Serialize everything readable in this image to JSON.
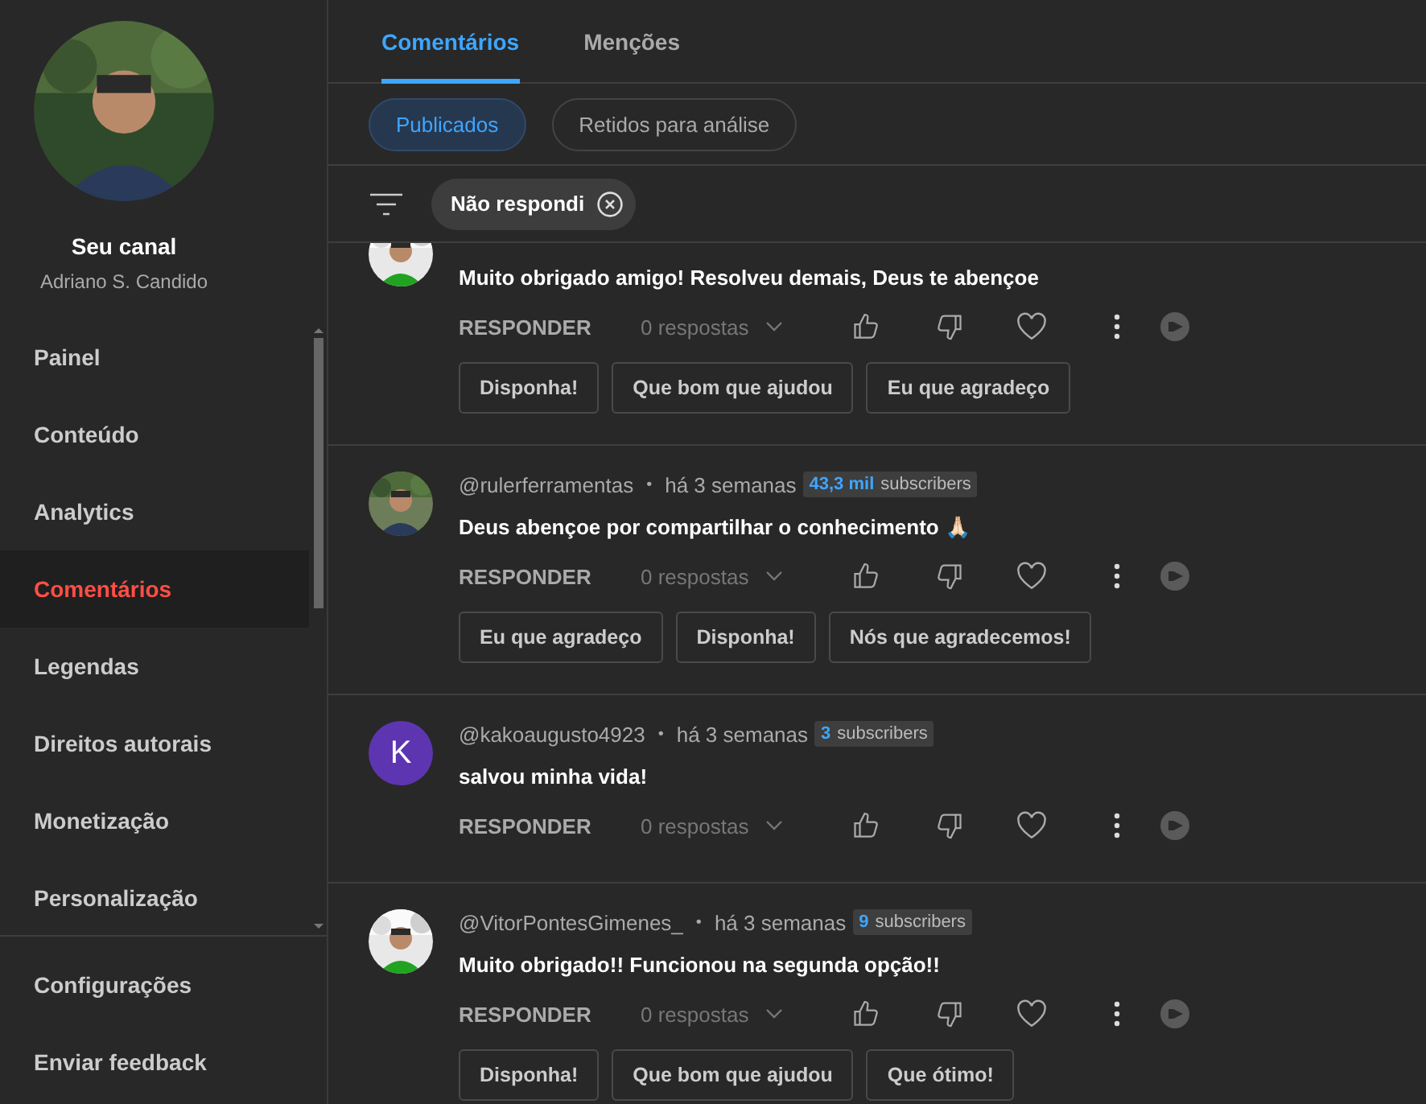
{
  "sidebar": {
    "avatar": {
      "kind": "picture"
    },
    "title": "Seu canal",
    "subtitle": "Adriano S. Candido",
    "items": [
      {
        "label": "Painel",
        "selected": false
      },
      {
        "label": "Conteúdo",
        "selected": false
      },
      {
        "label": "Analytics",
        "selected": false
      },
      {
        "label": "Comentários",
        "selected": true
      },
      {
        "label": "Legendas",
        "selected": false
      },
      {
        "label": "Direitos autorais",
        "selected": false
      },
      {
        "label": "Monetização",
        "selected": false
      },
      {
        "label": "Personalização",
        "selected": false
      }
    ],
    "footer_items": [
      {
        "label": "Configurações"
      },
      {
        "label": "Enviar feedback"
      }
    ]
  },
  "tabs": [
    {
      "label": "Comentários",
      "selected": true
    },
    {
      "label": "Menções",
      "selected": false
    }
  ],
  "chips": [
    {
      "label": "Publicados",
      "selected": true
    },
    {
      "label": "Retidos para análise",
      "selected": false
    }
  ],
  "filter": {
    "label": "Não respondi"
  },
  "comments": [
    {
      "avatar": {
        "kind": "picture"
      },
      "text": "Muito obrigado amigo! Resolveu demais, Deus te abençoe",
      "reply": "RESPONDER",
      "replies": "0 respostas",
      "suggestions": [
        "Disponha!",
        "Que bom que ajudou",
        "Eu que agradeço"
      ]
    },
    {
      "avatar": {
        "kind": "picture"
      },
      "author": "@rulerferramentas",
      "separator": "•",
      "time": "há 3 semanas",
      "badge": {
        "count": "43,3 mil",
        "label": "subscribers"
      },
      "text": "Deus abençoe por compartilhar o conhecimento 🙏🏻",
      "reply": "RESPONDER",
      "replies": "0 respostas",
      "suggestions": [
        "Eu que agradeço",
        "Disponha!",
        "Nós que agradecemos!"
      ]
    },
    {
      "avatar": {
        "kind": "letter",
        "letter": "K",
        "color": "#5e35b1"
      },
      "author": "@kakoaugusto4923",
      "separator": "•",
      "time": "há 3 semanas",
      "badge": {
        "count": "3",
        "label": "subscribers"
      },
      "text": "salvou minha vida!",
      "reply": "RESPONDER",
      "replies": "0 respostas"
    },
    {
      "avatar": {
        "kind": "picture"
      },
      "author": "@VitorPontesGimenes_",
      "separator": "•",
      "time": "há 3 semanas",
      "badge": {
        "count": "9",
        "label": "subscribers"
      },
      "text": "Muito obrigado!! Funcionou na segunda opção!!",
      "reply": "RESPONDER",
      "replies": "0 respostas",
      "suggestions": [
        "Disponha!",
        "Que bom que ajudou",
        "Que ótimo!"
      ]
    }
  ]
}
